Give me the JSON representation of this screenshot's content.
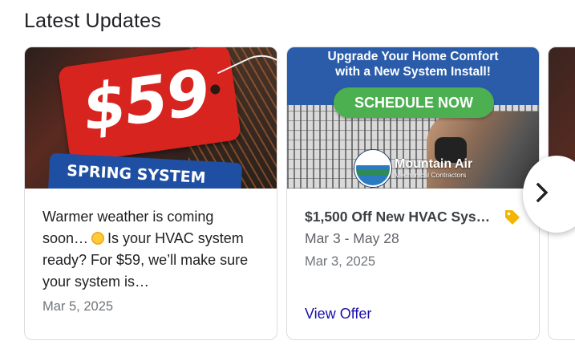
{
  "section": {
    "title": "Latest Updates"
  },
  "cards": [
    {
      "image": {
        "price": "$59",
        "banner": "SPRING SYSTEM"
      },
      "text_before_icon": "Warmer weather is coming soon…",
      "icon": "sun-emoji",
      "text_after_icon": "Is your HVAC system ready? For $59, we’ll make sure your system is…",
      "date": "Mar 5, 2025"
    },
    {
      "image": {
        "headline_line1": "Upgrade Your Home Comfort",
        "headline_line2": "with a New System Install!",
        "cta": "SCHEDULE NOW",
        "logo_name": "Mountain Air",
        "logo_sub": "Mechanical Contractors"
      },
      "title": "$1,500 Off New HVAC Sys…",
      "icon": "offer-tag-icon",
      "date_range": "Mar 3 - May 28",
      "date": "Mar 3, 2025",
      "link": "View Offer"
    }
  ],
  "carousel": {
    "next_icon": "chevron-right-icon"
  },
  "colors": {
    "link": "#1a0dab",
    "tag": "#f4b400",
    "card_border": "#dadce0"
  }
}
